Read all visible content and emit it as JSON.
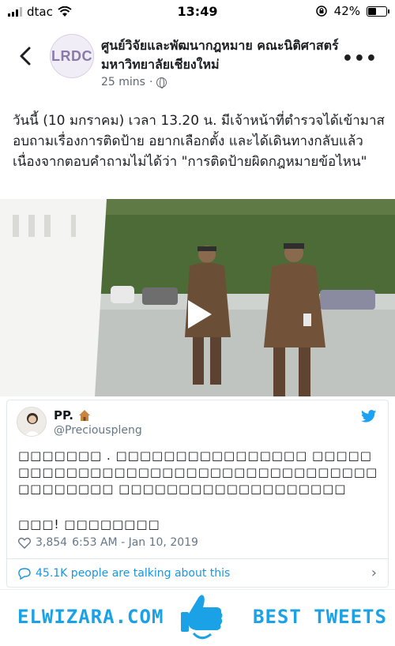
{
  "status_bar": {
    "carrier": "dtac",
    "time": "13:49",
    "battery": "42%"
  },
  "post": {
    "page_logo_text": "LRDC",
    "page_name": "ศูนย์วิจัยและพัฒนากฎหมาย คณะนิติศาสตร์ มหาวิทยาลัยเชียงใหม่",
    "time": "25 mins",
    "text": "วันนี้ (10 มกราคม) เวลา 13.20 น. มีเจ้าหน้าที่ตำรวจได้เข้ามาสอบถามเรื่องการติดป้าย อยากเลือกตั้ง และได้เดินทางกลับแล้ว เนื่องจากตอบคำถามไม่ได้ว่า \"การติดป้ายผิดกฎหมายข้อไหน\""
  },
  "tweet": {
    "name": "PP.",
    "handle": "@Preciouspleng",
    "text_line1": "□□□□□□□ . □□□□□□□□□□□□□□□□ □□□□□□□□□□□□□□□□□□□□□□□□□□□□□□□□□□□□□□□□□□□ □□□□□□□□□□□□□□□□□□□",
    "text_line2": "□□□! □□□□□□□□",
    "likes": "3,854",
    "timestamp": "6:53 AM - Jan 10, 2019",
    "talking": "45.1K people are talking about this"
  },
  "footer": {
    "left_text": "ELWIZARA.COM",
    "right_text": "BEST TWEETS"
  },
  "colors": {
    "twitter_blue": "#1b95e0",
    "banner_blue": "#1aa1e6",
    "logo_purple": "#8a7aa8"
  }
}
